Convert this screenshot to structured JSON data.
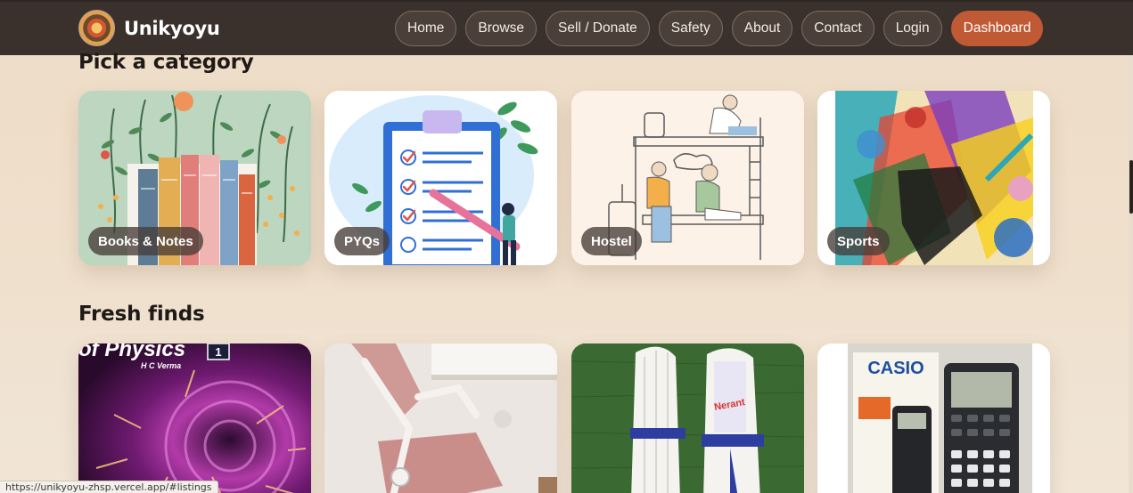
{
  "brand": {
    "name": "Unikyoyu"
  },
  "nav": {
    "items": [
      "Home",
      "Browse",
      "Sell / Donate",
      "Safety",
      "About",
      "Contact",
      "Login"
    ],
    "cta": "Dashboard"
  },
  "sections": {
    "categories_title": "Pick a category",
    "fresh_title": "Fresh finds"
  },
  "categories": [
    {
      "label": "Books & Notes"
    },
    {
      "label": "PYQs"
    },
    {
      "label": "Hostel"
    },
    {
      "label": "Sports"
    }
  ],
  "fresh_items": [
    {
      "cover_title": "of Physics",
      "cover_author": "H C Verma",
      "cover_badge": "1"
    },
    {
      "subject": "pink office chair"
    },
    {
      "brand_text": "Nerant",
      "subject": "cricket batting pads"
    },
    {
      "brand_text": "CASIO",
      "subject": "scientific calculator"
    }
  ],
  "status_bar": {
    "url": "https://unikyoyu-zhsp.vercel.app/#listings"
  },
  "colors": {
    "nav_bg": "#3b312c",
    "accent": "#bf5a34",
    "page_bg": "#eedcc6"
  }
}
